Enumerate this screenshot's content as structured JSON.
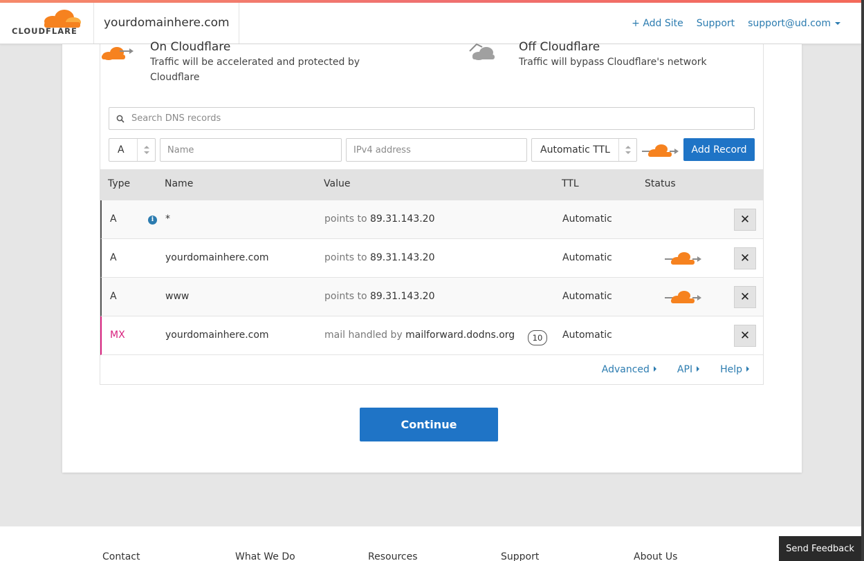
{
  "header": {
    "logo_text": "CLOUDFLARE",
    "site": "yourdomainhere.com",
    "nav": {
      "add_site": "+ Add Site",
      "support": "Support",
      "account": "support@ud.com"
    }
  },
  "proxy": {
    "on_title": "On Cloudflare",
    "on_desc": "Traffic will be accelerated and protected by Cloudflare",
    "off_title": "Off Cloudflare",
    "off_desc": "Traffic will bypass Cloudflare's network"
  },
  "search": {
    "placeholder": "Search DNS records"
  },
  "add_record": {
    "type_value": "A",
    "name_placeholder": "Name",
    "value_placeholder": "IPv4 address",
    "ttl_value": "Automatic TTL",
    "button_label": "Add Record"
  },
  "table": {
    "headers": [
      "Type",
      "Name",
      "Value",
      "TTL",
      "Status"
    ],
    "rows": [
      {
        "type": "A",
        "name": "*",
        "value_prefix": "points to",
        "value": "89.31.143.20",
        "ttl": "Automatic",
        "proxied": false,
        "info": true
      },
      {
        "type": "A",
        "name": "yourdomainhere.com",
        "value_prefix": "points to",
        "value": "89.31.143.20",
        "ttl": "Automatic",
        "proxied": true
      },
      {
        "type": "A",
        "name": "www",
        "value_prefix": "points to",
        "value": "89.31.143.20",
        "ttl": "Automatic",
        "proxied": true
      },
      {
        "type": "MX",
        "name": "yourdomainhere.com",
        "value_prefix": "mail handled by",
        "value": "mailforward.dodns.org",
        "priority": "10",
        "ttl": "Automatic",
        "proxied": false
      }
    ]
  },
  "links": {
    "advanced": "Advanced",
    "api": "API",
    "help": "Help"
  },
  "continue_label": "Continue",
  "footer": [
    "Contact",
    "What We Do",
    "Resources",
    "Support",
    "About Us"
  ],
  "feedback_label": "Send Feedback",
  "colors": {
    "accent": "#1f74c6",
    "link": "#2c7cb0",
    "cloud": "#f6821f",
    "mx": "#d8217e"
  }
}
